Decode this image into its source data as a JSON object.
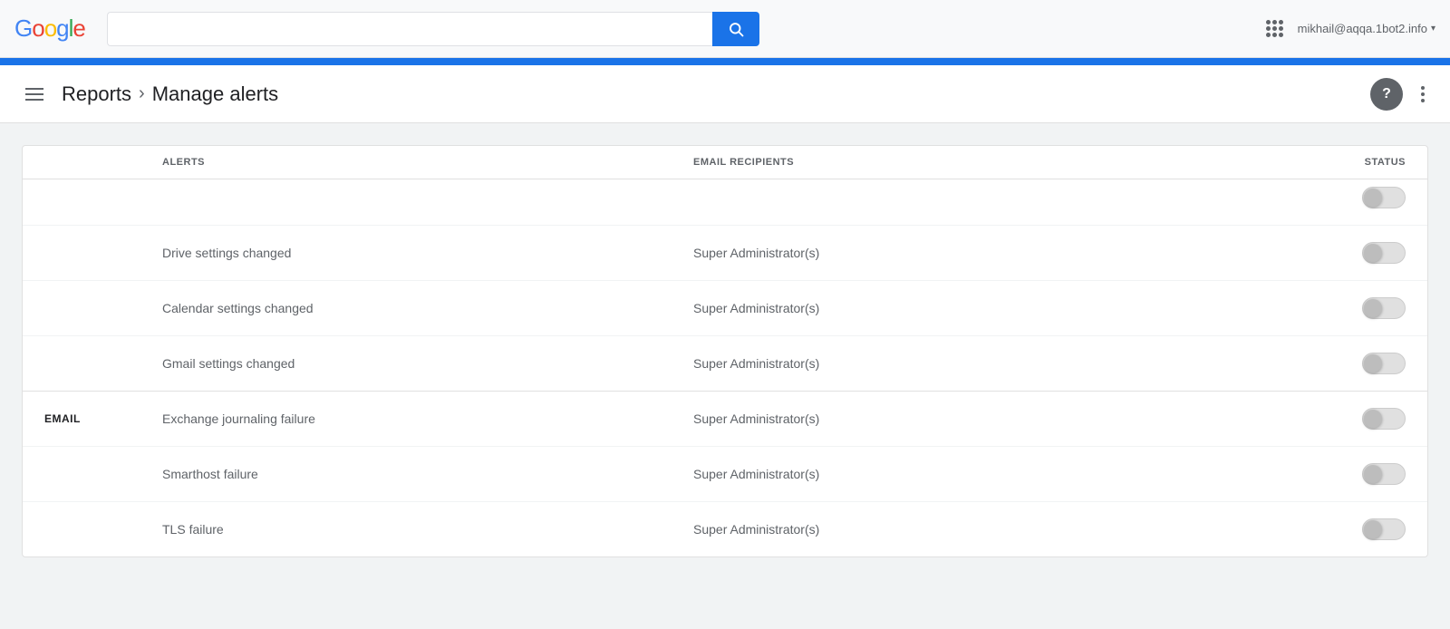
{
  "topbar": {
    "logo": [
      "G",
      "o",
      "o",
      "g",
      "l",
      "e"
    ],
    "search_placeholder": "",
    "search_button_label": "Search",
    "user_email": "mikhail@aqqa.1bot2.info"
  },
  "subheader": {
    "breadcrumb_parent": "Reports",
    "breadcrumb_separator": "›",
    "breadcrumb_current": "Manage alerts",
    "help_label": "?",
    "more_label": "⋮"
  },
  "table": {
    "columns": {
      "alerts": "ALERTS",
      "recipients": "EMAIL RECIPIENTS",
      "status": "STATUS"
    },
    "rows": [
      {
        "category": "",
        "alert": "",
        "recipients": "",
        "status": "off",
        "partial": true
      },
      {
        "category": "",
        "alert": "Drive settings changed",
        "recipients": "Super Administrator(s)",
        "status": "off"
      },
      {
        "category": "",
        "alert": "Calendar settings changed",
        "recipients": "Super Administrator(s)",
        "status": "off"
      },
      {
        "category": "",
        "alert": "Gmail settings changed",
        "recipients": "Super Administrator(s)",
        "status": "off"
      },
      {
        "category": "EMAIL",
        "alert": "Exchange journaling failure",
        "recipients": "Super Administrator(s)",
        "status": "off"
      },
      {
        "category": "",
        "alert": "Smarthost failure",
        "recipients": "Super Administrator(s)",
        "status": "off"
      },
      {
        "category": "",
        "alert": "TLS failure",
        "recipients": "Super Administrator(s)",
        "status": "off"
      }
    ]
  }
}
